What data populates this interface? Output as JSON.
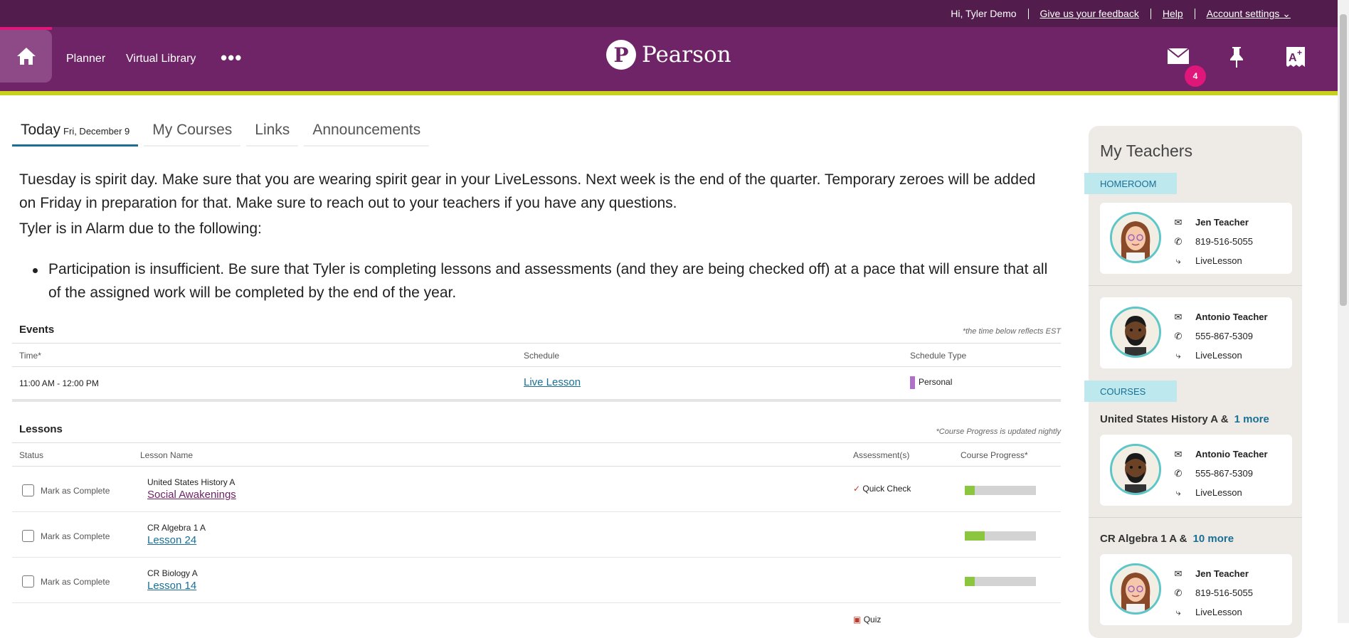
{
  "topbar": {
    "greeting": "Hi, Tyler Demo",
    "feedback": "Give us your feedback",
    "help": "Help",
    "account": "Account settings"
  },
  "nav": {
    "planner": "Planner",
    "virtual_library": "Virtual Library",
    "more": "•••",
    "logo_text": "Pearson",
    "mail_badge": "4"
  },
  "tabs": {
    "today": "Today",
    "today_date": "Fri, December 9",
    "my_courses": "My Courses",
    "links": "Links",
    "announcements": "Announcements"
  },
  "message": {
    "announcement": "Tuesday is spirit day. Make sure that you are wearing spirit gear in your LiveLessons. Next week is the end of the quarter. Temporary zeroes will be added on Friday in preparation for that. Make sure to reach out to your teachers if you have any questions.",
    "alarm": "Tyler is in Alarm due to the following:",
    "bullet": "Participation is insufficient. Be sure that Tyler is completing lessons and assessments (and they are being checked off) at a pace that will ensure that all of the assigned work will be completed by the end of the year."
  },
  "events": {
    "title": "Events",
    "note": "*the time below reflects EST",
    "col_time": "Time*",
    "col_schedule": "Schedule",
    "col_type": "Schedule Type",
    "rows": [
      {
        "time": "11:00 AM - 12:00 PM",
        "schedule": "Live Lesson",
        "type": "Personal"
      }
    ]
  },
  "lessons": {
    "title": "Lessons",
    "note": "*Course Progress is updated nightly",
    "col_status": "Status",
    "col_name": "Lesson Name",
    "col_assess": "Assessment(s)",
    "col_progress": "Course Progress*",
    "mark_label": "Mark as Complete",
    "rows": [
      {
        "course": "United States History A",
        "lesson": "Social Awakenings",
        "assessment": "Quick Check",
        "progress": 0.14
      },
      {
        "course": "CR Algebra 1 A",
        "lesson": "Lesson 24",
        "assessment": "",
        "progress": 0.28
      },
      {
        "course": "CR Biology A",
        "lesson": "Lesson 14",
        "assessment": "",
        "progress": 0.14
      }
    ],
    "partial_assessment": "Quiz"
  },
  "teachers": {
    "title": "My Teachers",
    "homeroom_label": "HOMEROOM",
    "courses_label": "COURSES",
    "homeroom": [
      {
        "name": "Jen Teacher",
        "phone": "819-516-5055",
        "live": "LiveLesson"
      },
      {
        "name": "Antonio Teacher",
        "phone": "555-867-5309",
        "live": "LiveLesson"
      }
    ],
    "course_groups": [
      {
        "course": "United States History A &",
        "more": "1 more",
        "name": "Antonio Teacher",
        "phone": "555-867-5309",
        "live": "LiveLesson"
      },
      {
        "course": "CR Algebra 1 A &",
        "more": "10 more",
        "name": "Jen Teacher",
        "phone": "819-516-5055",
        "live": "LiveLesson"
      }
    ]
  },
  "colors": {
    "topbar": "#521c4d",
    "navbar": "#6e2466",
    "accent": "#c8d21c",
    "badge": "#e0177a",
    "link": "#1a6f95",
    "progress": "#8cc63f"
  }
}
